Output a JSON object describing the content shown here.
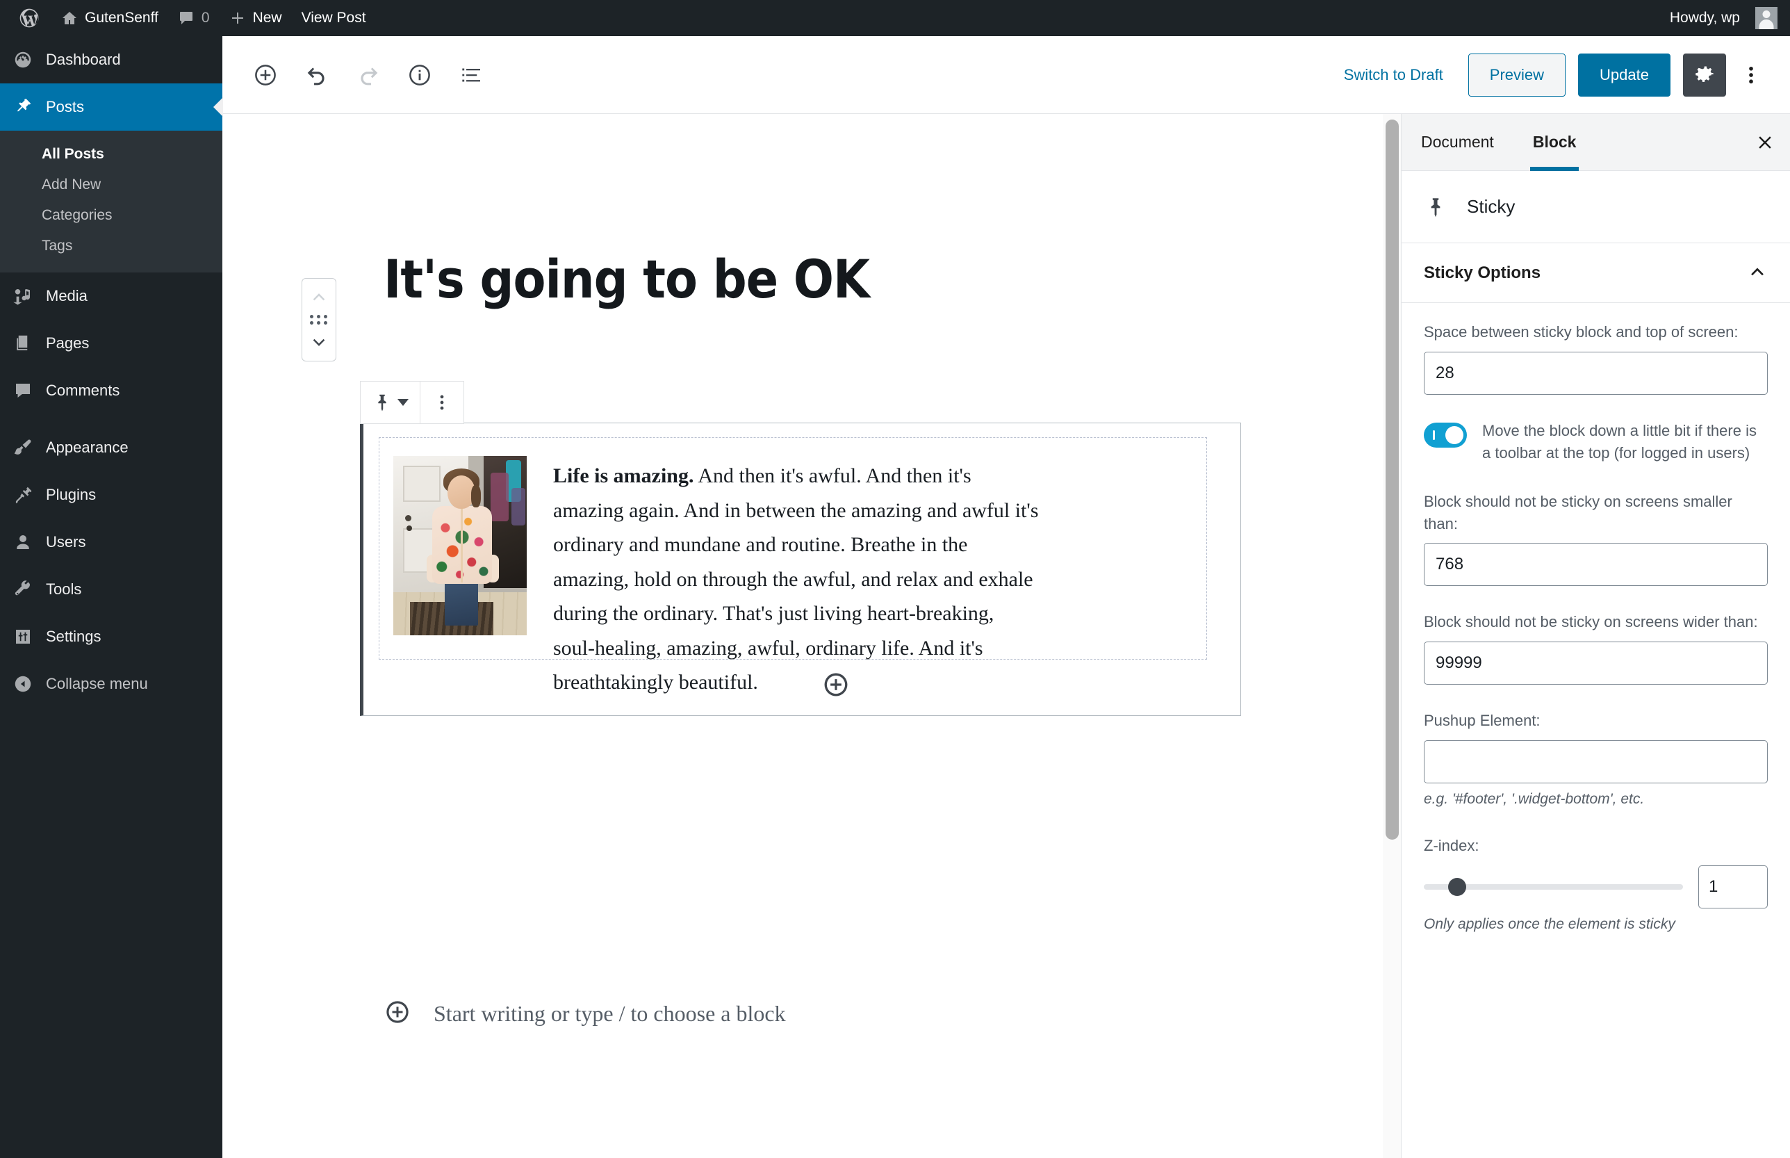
{
  "admin_bar": {
    "site_name": "GutenSenff",
    "comment_count": "0",
    "new_label": "New",
    "view_post_label": "View Post",
    "howdy": "Howdy, wp"
  },
  "admin_menu": {
    "items": [
      {
        "label": "Dashboard",
        "icon": "dashboard-icon"
      },
      {
        "label": "Posts",
        "icon": "pin-icon",
        "current": true
      },
      {
        "label": "Media",
        "icon": "media-icon"
      },
      {
        "label": "Pages",
        "icon": "pages-icon"
      },
      {
        "label": "Comments",
        "icon": "comment-icon"
      },
      {
        "label": "Appearance",
        "icon": "brush-icon"
      },
      {
        "label": "Plugins",
        "icon": "plug-icon"
      },
      {
        "label": "Users",
        "icon": "user-icon"
      },
      {
        "label": "Tools",
        "icon": "wrench-icon"
      },
      {
        "label": "Settings",
        "icon": "sliders-icon"
      }
    ],
    "submenu": [
      {
        "label": "All Posts",
        "current": true
      },
      {
        "label": "Add New"
      },
      {
        "label": "Categories"
      },
      {
        "label": "Tags"
      }
    ],
    "collapse_label": "Collapse menu"
  },
  "editor_header": {
    "add_block_title": "Add block",
    "undo_title": "Undo",
    "redo_title": "Redo",
    "info_title": "Content structure",
    "block_nav_title": "Block navigation",
    "switch_to_draft": "Switch to Draft",
    "preview": "Preview",
    "update": "Update",
    "settings_title": "Settings",
    "more_title": "More tools & options"
  },
  "post": {
    "title": "It's going to be OK",
    "paragraph_lead": "Life is amazing.",
    "paragraph_rest": " And then it's awful. And then it's amazing again. And in between the amazing and awful it's ordinary and mundane and routine. Breathe in the amazing, hold on through the awful, and relax and exhale during the ordinary. That's just living heart-breaking, soul-healing, amazing, awful, ordinary life. And it's breathtakingly beautiful.",
    "image_alt": "Smiling girl in a floral bomber jacket standing by a door",
    "default_appender_placeholder": "Start writing or type / to choose a block"
  },
  "block_toolbar": {
    "block_type_title": "Sticky",
    "change_block_type_title": "Change block type",
    "more_options_title": "More options"
  },
  "block_mover": {
    "move_up_title": "Move up",
    "drag_title": "Drag block",
    "move_down_title": "Move down"
  },
  "settings_sidebar": {
    "tabs": [
      {
        "label": "Document",
        "active": false
      },
      {
        "label": "Block",
        "active": true
      }
    ],
    "close_title": "Close settings",
    "block_name": "Sticky",
    "panel_title": "Sticky Options",
    "fields": {
      "space_label": "Space between sticky block and top of screen:",
      "space_value": "28",
      "toolbar_toggle_label": "Move the block down a little bit if there is a toolbar at the top (for logged in users)",
      "toolbar_toggle_on": true,
      "min_width_label": "Block should not be sticky on screens smaller than:",
      "min_width_value": "768",
      "max_width_label": "Block should not be sticky on screens wider than:",
      "max_width_value": "99999",
      "pushup_label": "Pushup Element:",
      "pushup_value": "",
      "pushup_help": "e.g. '#footer', '.widget-bottom', etc.",
      "zindex_label": "Z-index:",
      "zindex_value": "1",
      "zindex_help": "Only applies once the element is sticky",
      "zindex_slider_percent": 13
    }
  },
  "colors": {
    "admin_dark": "#1d2327",
    "admin_accent": "#0073aa",
    "wp_blue": "#0071a1",
    "toggle_on": "#11a0d2",
    "panel_border": "#e2e4e7"
  }
}
